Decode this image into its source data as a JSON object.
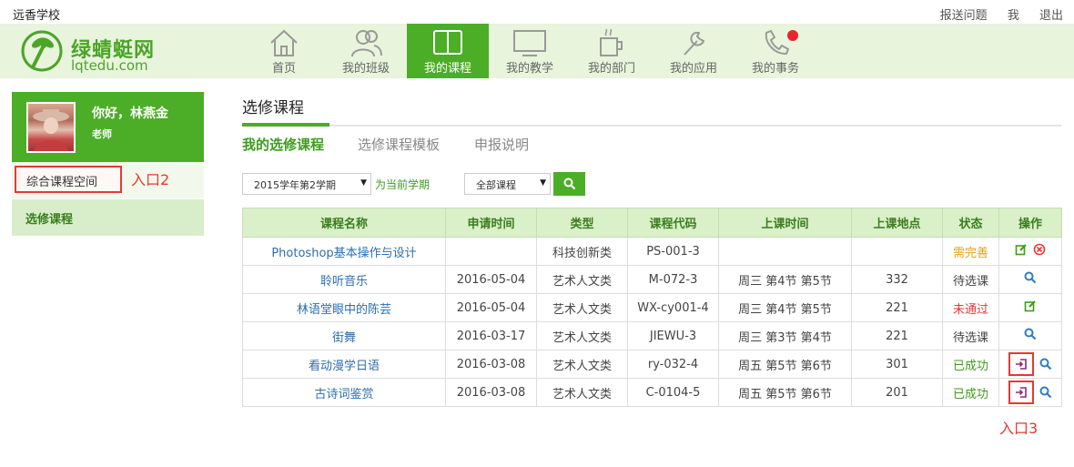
{
  "header": {
    "school": "远香学校",
    "links": [
      "报送问题",
      "我",
      "退出"
    ]
  },
  "logo": {
    "cn": "绿蜻蜓网",
    "en": "lqtedu.com"
  },
  "nav": [
    {
      "label": "首页",
      "icon": "home-icon"
    },
    {
      "label": "我的班级",
      "icon": "people-icon"
    },
    {
      "label": "我的课程",
      "icon": "book-icon",
      "active": true
    },
    {
      "label": "我的教学",
      "icon": "monitor-icon"
    },
    {
      "label": "我的部门",
      "icon": "coffee-cup-icon"
    },
    {
      "label": "我的应用",
      "icon": "wrench-icon"
    },
    {
      "label": "我的事务",
      "icon": "phone-icon",
      "badge": true
    }
  ],
  "sidebar": {
    "greeting": "你好，林燕金",
    "role": "老师",
    "items": [
      {
        "label": "综合课程空间"
      },
      {
        "label": "选修课程"
      }
    ],
    "annotation": "入口2"
  },
  "main": {
    "title": "选修课程",
    "tabs": [
      "我的选修课程",
      "选修课程模板",
      "申报说明"
    ],
    "filters": {
      "term": "2015学年第2学期",
      "set_current": "为当前学期",
      "course_filter": "全部课程"
    },
    "table": {
      "columns": [
        "课程名称",
        "申请时间",
        "类型",
        "课程代码",
        "上课时间",
        "上课地点",
        "状态",
        "操作"
      ],
      "rows": [
        {
          "name": "Photoshop基本操作与设计",
          "date": "",
          "type": "科技创新类",
          "code": "PS-001-3",
          "time": "",
          "place": "",
          "status": "需完善",
          "status_color": "#e3a01a",
          "ops": [
            "edit-icon",
            "delete-icon"
          ]
        },
        {
          "name": "聆听音乐",
          "date": "2016-05-04",
          "type": "艺术人文类",
          "code": "M-072-3",
          "time": "周三 第4节 第5节",
          "place": "332",
          "status": "待选课",
          "status_color": "#444444",
          "ops": [
            "search-icon"
          ]
        },
        {
          "name": "林语堂眼中的陈芸",
          "date": "2016-05-04",
          "type": "艺术人文类",
          "code": "WX-cy001-4",
          "time": "周三 第4节 第5节",
          "place": "221",
          "status": "未通过",
          "status_color": "#e53935",
          "ops": [
            "edit-icon"
          ]
        },
        {
          "name": "街舞",
          "date": "2016-03-17",
          "type": "艺术人文类",
          "code": "JIEWU-3",
          "time": "周三 第3节 第4节",
          "place": "221",
          "status": "待选课",
          "status_color": "#444444",
          "ops": [
            "search-icon"
          ]
        },
        {
          "name": "看动漫学日语",
          "date": "2016-03-08",
          "type": "艺术人文类",
          "code": "ry-032-4",
          "time": "周五 第5节 第6节",
          "place": "301",
          "status": "已成功",
          "status_color": "#3d9c1c",
          "ops": [
            "enter-icon",
            "search-icon"
          ]
        },
        {
          "name": "古诗词鉴赏",
          "date": "2016-03-08",
          "type": "艺术人文类",
          "code": "C-0104-5",
          "time": "周五 第5节 第6节",
          "place": "201",
          "status": "已成功",
          "status_color": "#3d9c1c",
          "ops": [
            "enter-icon",
            "search-icon"
          ]
        }
      ]
    },
    "annotation": "入口3"
  },
  "colors": {
    "brand_green": "#4cad27",
    "annotation_red": "#e53935"
  }
}
